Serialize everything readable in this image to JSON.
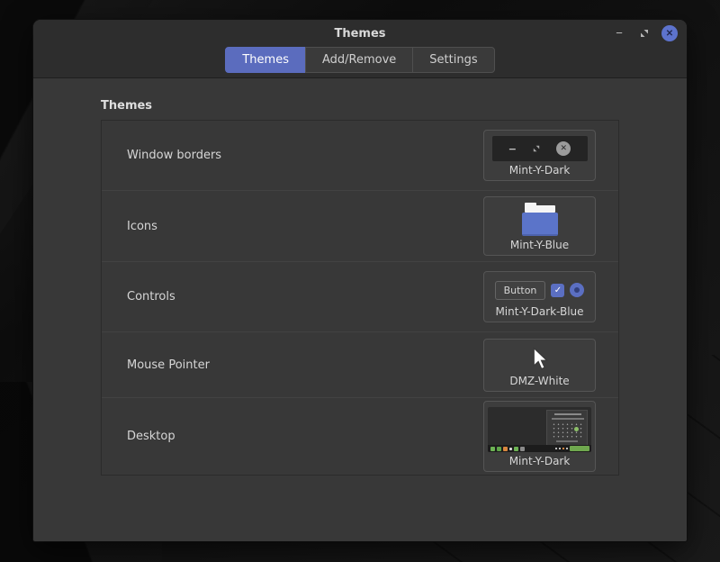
{
  "window": {
    "title": "Themes"
  },
  "icons": {
    "minimize_glyph": "−",
    "close_glyph": "✕",
    "check_glyph": "✓"
  },
  "tabs": [
    {
      "label": "Themes",
      "active": true
    },
    {
      "label": "Add/Remove",
      "active": false
    },
    {
      "label": "Settings",
      "active": false
    }
  ],
  "section": {
    "header": "Themes"
  },
  "rows": [
    {
      "label": "Window borders",
      "value": "Mint-Y-Dark"
    },
    {
      "label": "Icons",
      "value": "Mint-Y-Blue"
    },
    {
      "label": "Controls",
      "value": "Mint-Y-Dark-Blue",
      "button_label": "Button"
    },
    {
      "label": "Mouse Pointer",
      "value": "DMZ-White"
    },
    {
      "label": "Desktop",
      "value": "Mint-Y-Dark"
    }
  ],
  "colors": {
    "accent": "#5b6cbe",
    "close_button": "#5d73cd",
    "headerbar": "#2d2d2d",
    "content_bg": "#383838",
    "wallpaper": "#111111"
  }
}
